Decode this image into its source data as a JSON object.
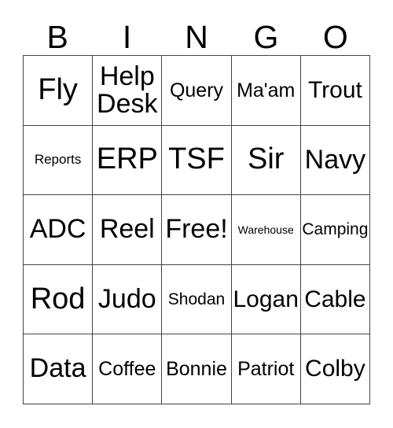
{
  "card": {
    "header": {
      "letters": [
        "B",
        "I",
        "N",
        "G",
        "O"
      ]
    },
    "columns": [
      "B",
      "I",
      "N",
      "G",
      "O"
    ],
    "rows": [
      {
        "cells": [
          {
            "text": "Fly",
            "size": "xxl",
            "free": false
          },
          {
            "text": "Help\nDesk",
            "size": "xl",
            "free": false
          },
          {
            "text": "Query",
            "size": "md",
            "free": false
          },
          {
            "text": "Ma'am",
            "size": "md",
            "free": false
          },
          {
            "text": "Trout",
            "size": "lg",
            "free": false
          }
        ]
      },
      {
        "cells": [
          {
            "text": "Reports",
            "size": "xs",
            "free": false
          },
          {
            "text": "ERP",
            "size": "xxl",
            "free": false
          },
          {
            "text": "TSF",
            "size": "xxl",
            "free": false
          },
          {
            "text": "Sir",
            "size": "xxl",
            "free": false
          },
          {
            "text": "Navy",
            "size": "xl",
            "free": false
          }
        ]
      },
      {
        "cells": [
          {
            "text": "ADC",
            "size": "xl",
            "free": false
          },
          {
            "text": "Reel",
            "size": "xl",
            "free": false
          },
          {
            "text": "Free!",
            "size": "xl",
            "free": true
          },
          {
            "text": "Warehouse",
            "size": "xxs",
            "free": false
          },
          {
            "text": "Camping",
            "size": "sm",
            "free": false
          }
        ]
      },
      {
        "cells": [
          {
            "text": "Rod",
            "size": "xxl",
            "free": false
          },
          {
            "text": "Judo",
            "size": "xl",
            "free": false
          },
          {
            "text": "Shodan",
            "size": "sm",
            "free": false
          },
          {
            "text": "Logan",
            "size": "lg",
            "free": false
          },
          {
            "text": "Cable",
            "size": "lg",
            "free": false
          }
        ]
      },
      {
        "cells": [
          {
            "text": "Data",
            "size": "xl",
            "free": false
          },
          {
            "text": "Coffee",
            "size": "md",
            "free": false
          },
          {
            "text": "Bonnie",
            "size": "md",
            "free": false
          },
          {
            "text": "Patriot",
            "size": "md",
            "free": false
          },
          {
            "text": "Colby",
            "size": "lg",
            "free": false
          }
        ]
      }
    ]
  },
  "style": {
    "background_color": "#ffffff",
    "text_color": "#000000",
    "border_color": "#444444"
  }
}
